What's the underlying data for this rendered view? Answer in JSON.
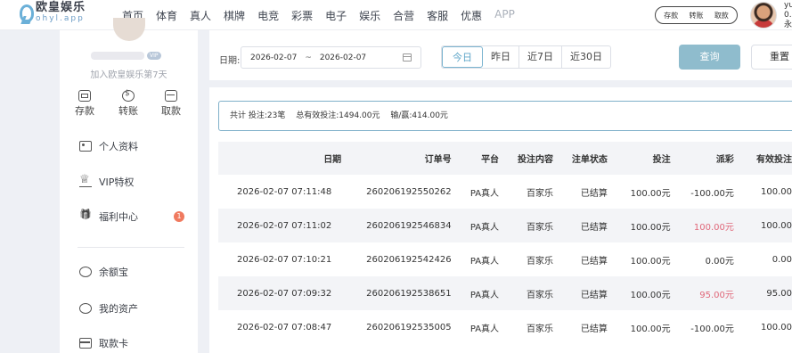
{
  "brand": {
    "name_cn": "欧皇娱乐",
    "name_en": "ohyl.app"
  },
  "nav": [
    "首页",
    "体育",
    "真人",
    "棋牌",
    "电竞",
    "彩票",
    "电子",
    "娱乐",
    "合营",
    "客服",
    "优惠",
    "APP"
  ],
  "top_actions": [
    "存款",
    "转账",
    "取款"
  ],
  "user": {
    "line1": "yu",
    "line2": "0.",
    "line3": "永"
  },
  "sidebar": {
    "join_text": "加入欧皇娱乐第7天",
    "vip_badge": "VIP",
    "quick": [
      "存款",
      "转账",
      "取款"
    ],
    "menu": [
      {
        "label": "个人资料",
        "icon": "id-card-icon"
      },
      {
        "label": "VIP特权",
        "icon": "crown-icon"
      },
      {
        "label": "福利中心",
        "icon": "gift-icon",
        "badge": "1"
      },
      {
        "label": "余额宝",
        "icon": "coin-icon"
      },
      {
        "label": "我的资产",
        "icon": "smile-icon"
      },
      {
        "label": "取款卡",
        "icon": "card-icon"
      }
    ]
  },
  "filter": {
    "label": "日期:",
    "start": "2026-02-07",
    "separator": "~",
    "end": "2026-02-07",
    "quick_dates": [
      "今日",
      "昨日",
      "近7日",
      "近30日"
    ],
    "active_quick": "今日",
    "query_label": "查询",
    "reset_label": "重置"
  },
  "summary": {
    "total": "共计 投注:23笔",
    "valid": "总有效投注:1494.00元",
    "winloss": "输/赢:414.00元"
  },
  "table": {
    "headers": [
      "日期",
      "订单号",
      "平台",
      "投注内容",
      "注单状态",
      "投注",
      "派彩",
      "有效投注"
    ],
    "rows": [
      [
        "2026-02-07 07:11:48",
        "260206192550262",
        "PA真人",
        "百家乐",
        "已结算",
        "100.00元",
        "-100.00元",
        "100.00"
      ],
      [
        "2026-02-07 07:11:02",
        "260206192546834",
        "PA真人",
        "百家乐",
        "已结算",
        "100.00元",
        "100.00元",
        "100.00"
      ],
      [
        "2026-02-07 07:10:21",
        "260206192542426",
        "PA真人",
        "百家乐",
        "已结算",
        "100.00元",
        "0.00元",
        "0.00"
      ],
      [
        "2026-02-07 07:09:32",
        "260206192538651",
        "PA真人",
        "百家乐",
        "已结算",
        "100.00元",
        "95.00元",
        "95.00"
      ],
      [
        "2026-02-07 07:08:47",
        "260206192535005",
        "PA真人",
        "百家乐",
        "已结算",
        "100.00元",
        "-100.00元",
        "100.00"
      ]
    ],
    "win_color": "#e0687a"
  }
}
